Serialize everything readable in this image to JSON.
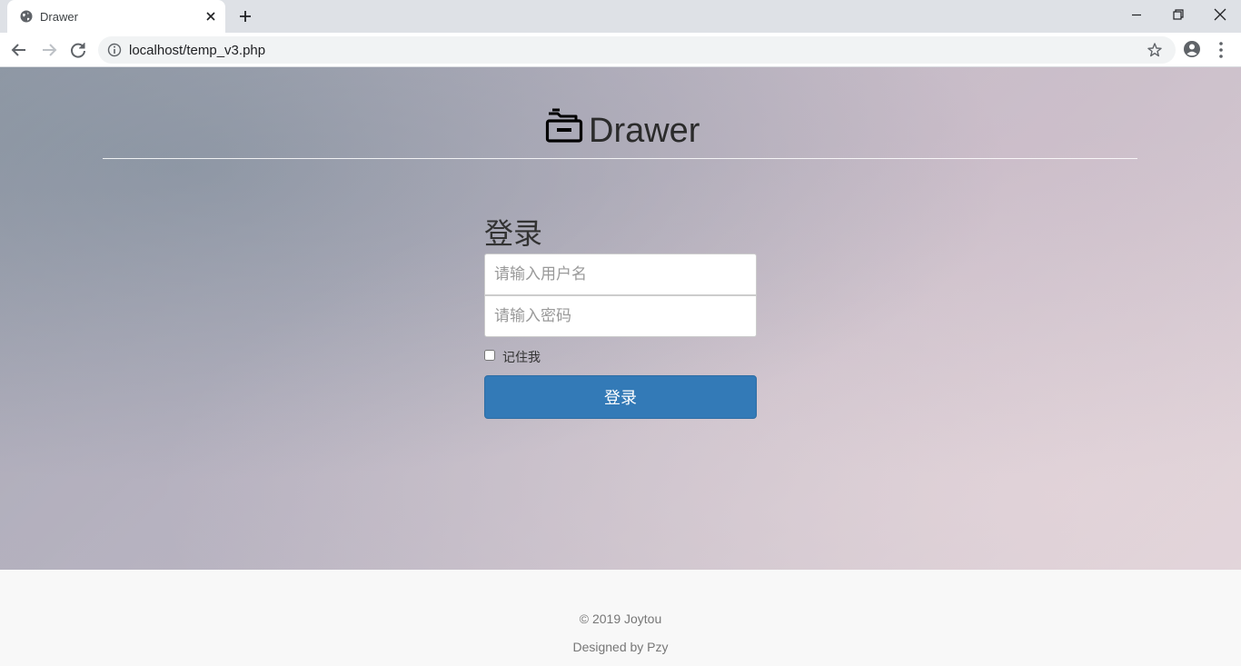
{
  "browser": {
    "tab": {
      "title": "Drawer"
    },
    "address_bar": {
      "url": "localhost/temp_v3.php"
    }
  },
  "header": {
    "brand": "Drawer",
    "icon": "drawer-icon"
  },
  "login": {
    "heading": "登录",
    "username_placeholder": "请输入用户名",
    "password_placeholder": "请输入密码",
    "remember_label": "记住我",
    "remember_checked": false,
    "submit_label": "登录"
  },
  "footer": {
    "copyright": "© 2019 Joytou",
    "credits": "Designed by Pzy"
  },
  "colors": {
    "primary_button": "#337ab7",
    "footer_bg": "#f8f8f8",
    "chrome_tabbar": "#dee1e6"
  }
}
